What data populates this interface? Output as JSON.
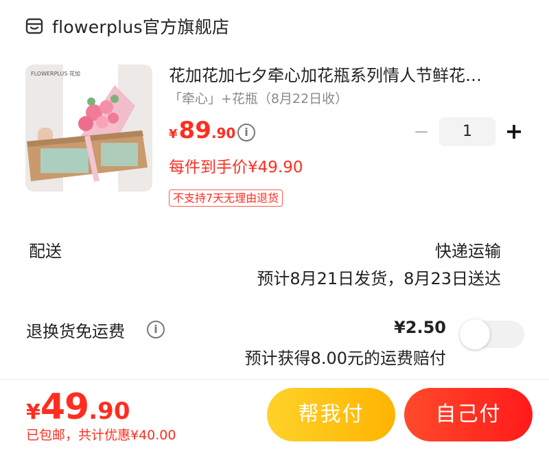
{
  "shop": {
    "icon": "store-icon",
    "name": "flowerplus官方旗舰店"
  },
  "product": {
    "image_brand_text": "FLOWERPLUS 花加",
    "title": "花加花加七夕牵心加花瓶系列情人节鲜花…",
    "spec": "「牵心」+花瓶（8月22日收）",
    "price": {
      "symbol": "¥",
      "integer": "89",
      "decimal": ".90"
    },
    "price_info_icon": "info-icon",
    "quantity": {
      "minus": "−",
      "value": "1",
      "plus": "+"
    },
    "unit_price_text": "每件到手价¥49.90",
    "return_badge": "不支持7天无理由退货"
  },
  "delivery": {
    "label": "配送",
    "method": "快递运输",
    "eta": "预计8月21日发货，8月23日送达"
  },
  "refund_shipping": {
    "label": "退换货免运费",
    "info_icon": "info-icon",
    "price": "¥2.50",
    "note": "预计获得8.00元的运费赔付",
    "toggle_on": false
  },
  "footer": {
    "total": {
      "symbol": "¥",
      "integer": "49",
      "decimal": ".90"
    },
    "note": "已包邮，共计优惠¥40.00",
    "help_pay_label": "帮我付",
    "self_pay_label": "自己付"
  },
  "colors": {
    "accent": "#ff2d1f",
    "help_button": "#ffc20e",
    "self_button": "#ff2a1f"
  }
}
